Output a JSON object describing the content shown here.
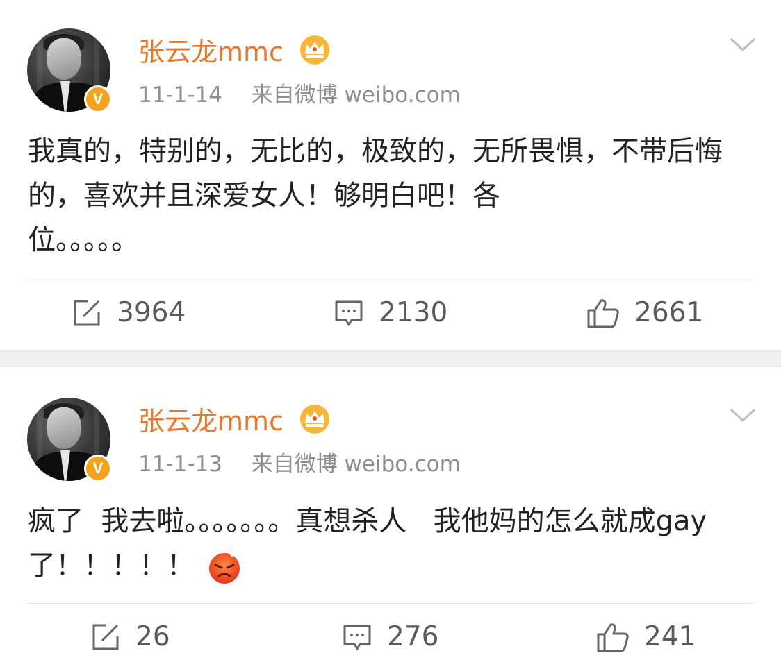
{
  "posts": [
    {
      "username": "张云龙mmc",
      "date": "11-1-14",
      "source": "来自微博 weibo.com",
      "content": "我真的，特别的，无比的，极致的，无所畏惧，不带后悔的，喜欢并且深爱女人！够明白吧！各\n位。。。。。",
      "reposts": "3964",
      "comments": "2130",
      "likes": "2661"
    },
    {
      "username": "张云龙mmc",
      "date": "11-1-13",
      "source": "来自微博 weibo.com",
      "content": "疯了  我去啦。。。。。。。真想杀人   我他妈的怎么就成gay了！！！！！",
      "reposts": "26",
      "comments": "276",
      "likes": "241"
    }
  ],
  "icons": {
    "verified_badge": "V",
    "crown": "crown-icon",
    "menu": "chevron-down-icon",
    "repost": "repost-icon",
    "comment": "comment-icon",
    "like": "thumbs-up-icon",
    "emoji": "angry-face-emoji"
  },
  "colors": {
    "username": "#e8782a",
    "meta": "#8e8e8e",
    "badge": "#f3a41c",
    "separator": "#f0f0f0"
  }
}
